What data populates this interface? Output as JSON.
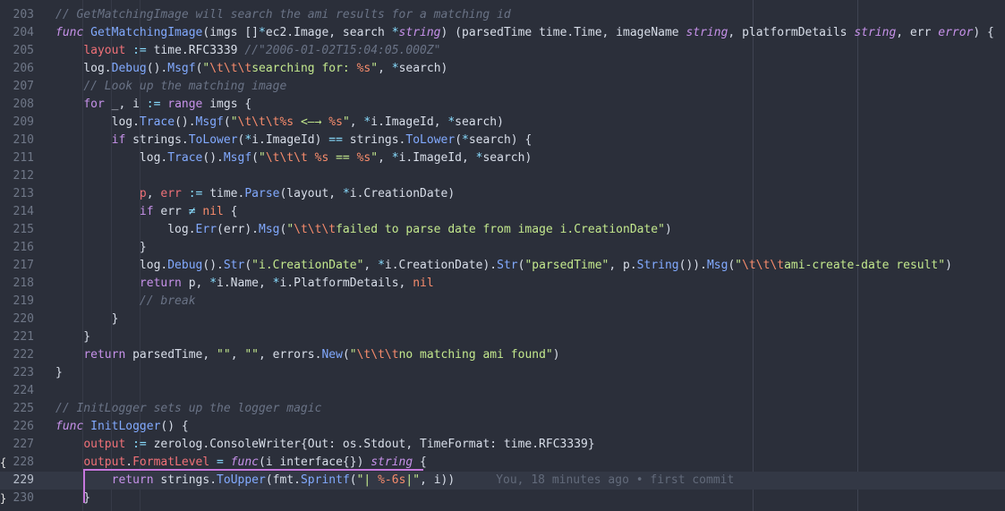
{
  "lines": [
    {
      "n": "203",
      "tokens": [
        [
          "cm",
          "// GetMatchingImage will search the ami results for a matching id"
        ]
      ]
    },
    {
      "n": "204",
      "tokens": [
        [
          "kwi",
          "func "
        ],
        [
          "fn",
          "GetMatchingImage"
        ],
        [
          "pl",
          "(imgs []"
        ],
        [
          "op",
          "*"
        ],
        [
          "pl",
          "ec2.Image, search "
        ],
        [
          "op",
          "*"
        ],
        [
          "ty",
          "string"
        ],
        [
          "pl",
          ") (parsedTime time.Time, imageName "
        ],
        [
          "ty",
          "string"
        ],
        [
          "pl",
          ", platformDetails "
        ],
        [
          "ty",
          "string"
        ],
        [
          "pl",
          ", err "
        ],
        [
          "ty",
          "error"
        ],
        [
          "pl",
          ") {"
        ]
      ]
    },
    {
      "n": "205",
      "tokens": [
        [
          "pl",
          "    "
        ],
        [
          "var",
          "layout"
        ],
        [
          "op",
          " := "
        ],
        [
          "pl",
          "time.RFC3339 "
        ],
        [
          "cm",
          "//\"2006-01-02T15:04:05.000Z\""
        ]
      ]
    },
    {
      "n": "206",
      "tokens": [
        [
          "pl",
          "    log."
        ],
        [
          "fn",
          "Debug"
        ],
        [
          "pl",
          "()."
        ],
        [
          "fn",
          "Msgf"
        ],
        [
          "pl",
          "("
        ],
        [
          "str",
          "\""
        ],
        [
          "esc",
          "\\t\\t\\t"
        ],
        [
          "str",
          "searching for: "
        ],
        [
          "fmt",
          "%s"
        ],
        [
          "str",
          "\""
        ],
        [
          "pl",
          ", "
        ],
        [
          "op",
          "*"
        ],
        [
          "pl",
          "search)"
        ]
      ]
    },
    {
      "n": "207",
      "tokens": [
        [
          "pl",
          "    "
        ],
        [
          "cm",
          "// Look up the matching image"
        ]
      ]
    },
    {
      "n": "208",
      "tokens": [
        [
          "pl",
          "    "
        ],
        [
          "kw",
          "for"
        ],
        [
          "pl",
          " _, i "
        ],
        [
          "op",
          ":="
        ],
        [
          "pl",
          " "
        ],
        [
          "kw",
          "range"
        ],
        [
          "pl",
          " imgs {"
        ]
      ]
    },
    {
      "n": "209",
      "tokens": [
        [
          "pl",
          "        log."
        ],
        [
          "fn",
          "Trace"
        ],
        [
          "pl",
          "()."
        ],
        [
          "fn",
          "Msgf"
        ],
        [
          "pl",
          "("
        ],
        [
          "str",
          "\""
        ],
        [
          "esc",
          "\\t\\t\\t"
        ],
        [
          "fmt",
          "%s"
        ],
        [
          "str",
          " <—→ "
        ],
        [
          "fmt",
          "%s"
        ],
        [
          "str",
          "\""
        ],
        [
          "pl",
          ", "
        ],
        [
          "op",
          "*"
        ],
        [
          "pl",
          "i.ImageId, "
        ],
        [
          "op",
          "*"
        ],
        [
          "pl",
          "search)"
        ]
      ]
    },
    {
      "n": "210",
      "tokens": [
        [
          "pl",
          "        "
        ],
        [
          "kw",
          "if"
        ],
        [
          "pl",
          " strings."
        ],
        [
          "fn",
          "ToLower"
        ],
        [
          "pl",
          "("
        ],
        [
          "op",
          "*"
        ],
        [
          "pl",
          "i.ImageId) "
        ],
        [
          "op",
          "=="
        ],
        [
          "pl",
          " strings."
        ],
        [
          "fn",
          "ToLower"
        ],
        [
          "pl",
          "("
        ],
        [
          "op",
          "*"
        ],
        [
          "pl",
          "search) {"
        ]
      ]
    },
    {
      "n": "211",
      "tokens": [
        [
          "pl",
          "            log."
        ],
        [
          "fn",
          "Trace"
        ],
        [
          "pl",
          "()."
        ],
        [
          "fn",
          "Msgf"
        ],
        [
          "pl",
          "("
        ],
        [
          "str",
          "\""
        ],
        [
          "esc",
          "\\t\\t\\t"
        ],
        [
          "str",
          " "
        ],
        [
          "fmt",
          "%s"
        ],
        [
          "str",
          " == "
        ],
        [
          "fmt",
          "%s"
        ],
        [
          "str",
          "\""
        ],
        [
          "pl",
          ", "
        ],
        [
          "op",
          "*"
        ],
        [
          "pl",
          "i.ImageId, "
        ],
        [
          "op",
          "*"
        ],
        [
          "pl",
          "search)"
        ]
      ]
    },
    {
      "n": "212",
      "tokens": []
    },
    {
      "n": "213",
      "tokens": [
        [
          "pl",
          "            "
        ],
        [
          "var",
          "p"
        ],
        [
          "pl",
          ", "
        ],
        [
          "var",
          "err"
        ],
        [
          "op",
          " := "
        ],
        [
          "pl",
          "time."
        ],
        [
          "fn",
          "Parse"
        ],
        [
          "pl",
          "(layout, "
        ],
        [
          "op",
          "*"
        ],
        [
          "pl",
          "i.CreationDate)"
        ]
      ]
    },
    {
      "n": "214",
      "tokens": [
        [
          "pl",
          "            "
        ],
        [
          "kw",
          "if"
        ],
        [
          "pl",
          " err "
        ],
        [
          "op",
          "≠"
        ],
        [
          "pl",
          " "
        ],
        [
          "nil",
          "nil"
        ],
        [
          "pl",
          " {"
        ]
      ]
    },
    {
      "n": "215",
      "tokens": [
        [
          "pl",
          "                log."
        ],
        [
          "fn",
          "Err"
        ],
        [
          "pl",
          "(err)."
        ],
        [
          "fn",
          "Msg"
        ],
        [
          "pl",
          "("
        ],
        [
          "str",
          "\""
        ],
        [
          "esc",
          "\\t\\t\\t"
        ],
        [
          "str",
          "failed to parse date from image i.CreationDate\""
        ],
        [
          "pl",
          ")"
        ]
      ]
    },
    {
      "n": "216",
      "tokens": [
        [
          "pl",
          "            }"
        ]
      ]
    },
    {
      "n": "217",
      "tokens": [
        [
          "pl",
          "            log."
        ],
        [
          "fn",
          "Debug"
        ],
        [
          "pl",
          "()."
        ],
        [
          "fn",
          "Str"
        ],
        [
          "pl",
          "("
        ],
        [
          "str",
          "\"i.CreationDate\""
        ],
        [
          "pl",
          ", "
        ],
        [
          "op",
          "*"
        ],
        [
          "pl",
          "i.CreationDate)."
        ],
        [
          "fn",
          "Str"
        ],
        [
          "pl",
          "("
        ],
        [
          "str",
          "\"parsedTime\""
        ],
        [
          "pl",
          ", p."
        ],
        [
          "fn",
          "String"
        ],
        [
          "pl",
          "())."
        ],
        [
          "fn",
          "Msg"
        ],
        [
          "pl",
          "("
        ],
        [
          "str",
          "\""
        ],
        [
          "esc",
          "\\t\\t\\t"
        ],
        [
          "str",
          "ami-create-date result\""
        ],
        [
          "pl",
          ")"
        ]
      ]
    },
    {
      "n": "218",
      "tokens": [
        [
          "pl",
          "            "
        ],
        [
          "kw",
          "return"
        ],
        [
          "pl",
          " p, "
        ],
        [
          "op",
          "*"
        ],
        [
          "pl",
          "i.Name, "
        ],
        [
          "op",
          "*"
        ],
        [
          "pl",
          "i.PlatformDetails, "
        ],
        [
          "nil",
          "nil"
        ]
      ]
    },
    {
      "n": "219",
      "tokens": [
        [
          "pl",
          "            "
        ],
        [
          "cm",
          "// break"
        ]
      ]
    },
    {
      "n": "220",
      "tokens": [
        [
          "pl",
          "        }"
        ]
      ]
    },
    {
      "n": "221",
      "tokens": [
        [
          "pl",
          "    }"
        ]
      ]
    },
    {
      "n": "222",
      "tokens": [
        [
          "pl",
          "    "
        ],
        [
          "kw",
          "return"
        ],
        [
          "pl",
          " parsedTime, "
        ],
        [
          "str",
          "\"\""
        ],
        [
          "pl",
          ", "
        ],
        [
          "str",
          "\"\""
        ],
        [
          "pl",
          ", errors."
        ],
        [
          "fn",
          "New"
        ],
        [
          "pl",
          "("
        ],
        [
          "str",
          "\""
        ],
        [
          "esc",
          "\\t\\t\\t"
        ],
        [
          "str",
          "no matching ami found\""
        ],
        [
          "pl",
          ")"
        ]
      ]
    },
    {
      "n": "223",
      "tokens": [
        [
          "pl",
          "}"
        ]
      ]
    },
    {
      "n": "224",
      "tokens": []
    },
    {
      "n": "225",
      "tokens": [
        [
          "cm",
          "// InitLogger sets up the logger magic"
        ]
      ]
    },
    {
      "n": "226",
      "tokens": [
        [
          "kwi",
          "func "
        ],
        [
          "fn",
          "InitLogger"
        ],
        [
          "pl",
          "() {"
        ]
      ]
    },
    {
      "n": "227",
      "tokens": [
        [
          "pl",
          "    "
        ],
        [
          "var",
          "output"
        ],
        [
          "op",
          " := "
        ],
        [
          "pl",
          "zerolog.ConsoleWriter{Out: os.Stdout, TimeFormat: time.RFC3339}"
        ]
      ]
    },
    {
      "n": "228",
      "gutter": "{",
      "tokens": [
        [
          "pl",
          "    "
        ],
        [
          "var",
          "output"
        ],
        [
          "pl",
          "."
        ],
        [
          "var",
          "FormatLevel"
        ],
        [
          "op",
          " = "
        ],
        [
          "kwi",
          "func"
        ],
        [
          "pl",
          "(i interface{}) "
        ],
        [
          "ty",
          "string"
        ],
        [
          "pl",
          " {"
        ]
      ]
    },
    {
      "n": "229",
      "current": true,
      "blame": "You, 18 minutes ago • first commit",
      "tokens": [
        [
          "pl",
          "        "
        ],
        [
          "kw",
          "return"
        ],
        [
          "pl",
          " strings."
        ],
        [
          "fn",
          "ToUpper"
        ],
        [
          "pl",
          "(fmt."
        ],
        [
          "fn",
          "Sprintf"
        ],
        [
          "pl",
          "("
        ],
        [
          "str",
          "\"| "
        ],
        [
          "fmt",
          "%-6s"
        ],
        [
          "str",
          "|\""
        ],
        [
          "pl",
          ", i))"
        ]
      ]
    },
    {
      "n": "230",
      "gutter": "}",
      "tokens": [
        [
          "pl",
          "    }"
        ]
      ]
    }
  ]
}
